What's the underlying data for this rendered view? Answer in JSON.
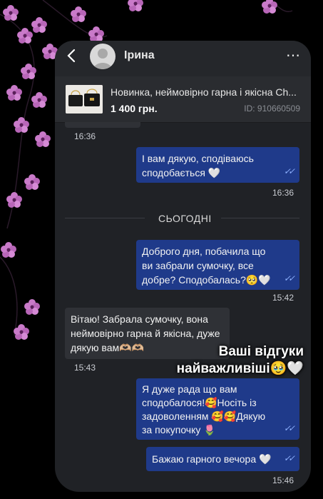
{
  "header": {
    "contact_name": "Ірина",
    "more_icon": "⋯",
    "back_icon": "chevron-left"
  },
  "product": {
    "title": "Новинка, неймовірно гарна і якісна Ch...",
    "price": "1 400 грн.",
    "id_label": "ID: 910660509"
  },
  "messages": {
    "m0_time": "16:36",
    "m1_text": "І вам дякую, сподіваюсь сподобається 🤍",
    "m1_time": "16:36",
    "date_divider": "СЬОГОДНІ",
    "m2_text": "Доброго дня, побачила що ви забрали сумочку, все добре? Сподобалась?🥺🤍",
    "m2_time": "15:42",
    "m3_text": "Вітаю! Забрала сумочку, вона неймовірно гарна й якісна, дуже дякую вам🫶🏼🫶🏼",
    "m3_time": "15:43",
    "m4_text": "Я дуже рада що вам сподобалося!🥰Носіть із задоволенням 🥰🥰Дякую за покупочку 🌷",
    "m5_text": "Бажаю гарного вечора 🤍",
    "m5_time": "15:46"
  },
  "overlay": {
    "line1": "Ваші відгуки",
    "line2": "найважливіші🥹🤍"
  },
  "colors": {
    "outgoing_bubble": "#1f3a8a",
    "incoming_bubble": "#2f3136",
    "chat_background": "#202226",
    "flower_pink": "#c97ac9"
  }
}
